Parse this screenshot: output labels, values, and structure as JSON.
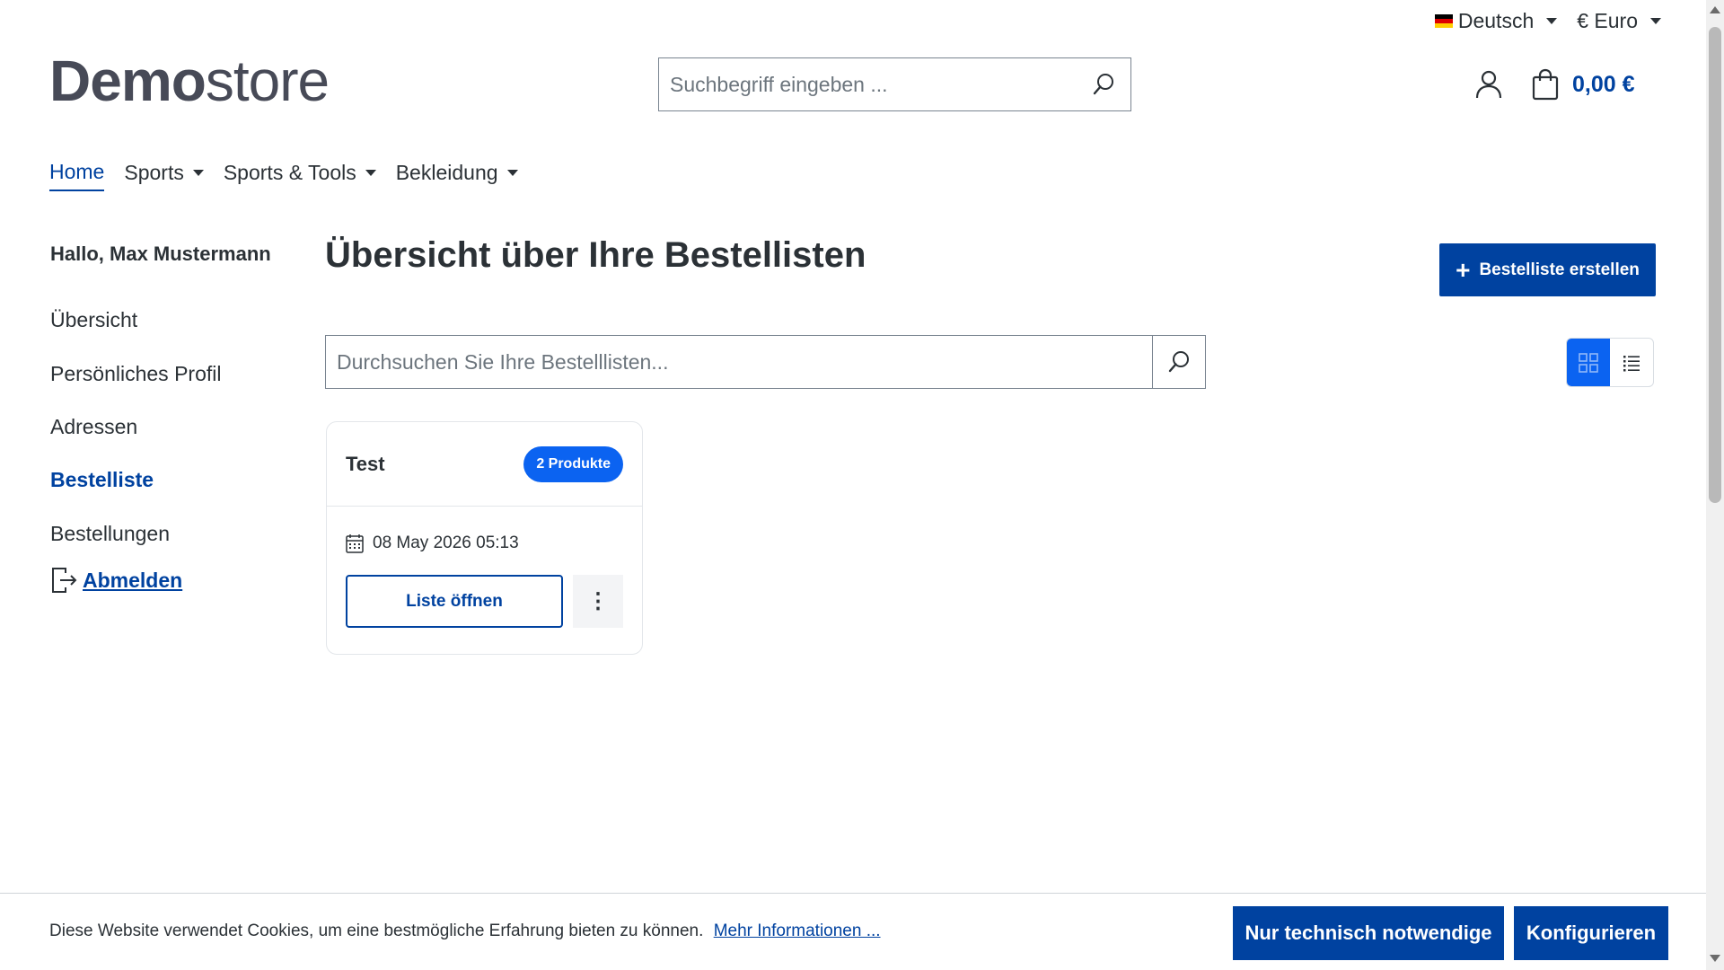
{
  "topbar": {
    "language": "Deutsch",
    "language_flag_icon": "flag-de-icon",
    "currency": "€ Euro"
  },
  "header": {
    "logo_bold": "Demo",
    "logo_light": "store",
    "search_placeholder": "Suchbegriff eingeben ...",
    "cart_total": "0,00 €"
  },
  "nav": {
    "items": [
      {
        "label": "Home",
        "active": true
      },
      {
        "label": "Sports",
        "dropdown": true
      },
      {
        "label": "Sports & Tools",
        "dropdown": true
      },
      {
        "label": "Bekleidung",
        "dropdown": true
      }
    ]
  },
  "sidebar": {
    "greeting": "Hallo, Max Mustermann",
    "items": [
      {
        "label": "Übersicht"
      },
      {
        "label": "Persönliches Profil"
      },
      {
        "label": "Adressen"
      },
      {
        "label": "Bestelliste",
        "active": true
      },
      {
        "label": "Bestellungen"
      }
    ],
    "logout_label": "Abmelden"
  },
  "main": {
    "title": "Übersicht über Ihre Bestellisten",
    "create_button": "Bestelliste erstellen",
    "search_placeholder": "Durchsuchen Sie Ihre Bestelllisten...",
    "lists": [
      {
        "name": "Test",
        "badge": "2 Produkte",
        "date": "08 May 2026 05:13",
        "open_label": "Liste öffnen"
      }
    ]
  },
  "cookie_banner": {
    "text": "Diese Website verwendet Cookies, um eine bestmögliche Erfahrung bieten zu können.",
    "link": "Mehr Informationen ...",
    "necessary_button": "Nur technisch notwendige",
    "configure_button": "Konfigurieren"
  },
  "colors": {
    "brand": "#0042a0",
    "accent": "#0b63f1",
    "text": "#2b3136"
  }
}
